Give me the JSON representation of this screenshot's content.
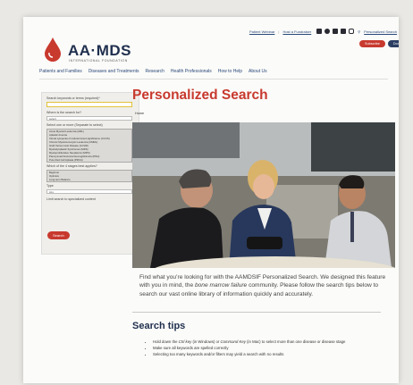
{
  "brand": {
    "logo_text": "AA·MDS",
    "logo_subtitle": "INTERNATIONAL FOUNDATION",
    "accent_red": "#c8392e",
    "navy": "#1f2f4e"
  },
  "top_links": [
    "Patient Webinar",
    "Host a Fundraiser",
    "Personalized Search"
  ],
  "social_icons": [
    "x-icon",
    "facebook-icon",
    "youtube-icon",
    "linkedin-icon",
    "instagram-icon"
  ],
  "top_buttons": {
    "subscribe": "Subscribe",
    "donate": "Donate"
  },
  "nav": {
    "items": [
      "Patients and Families",
      "Diseases and Treatments",
      "Research",
      "Health Professionals",
      "How to Help",
      "About Us"
    ]
  },
  "sidebar": {
    "q1": "Search keywords or terms (required)*",
    "q2": "Where is the search for?",
    "q2_value": "select",
    "q3": "Select one or more (Separate to select)",
    "conditions": [
      "Acute Myeloid Leukemia (AML)",
      "Aplastic Anemia",
      "Clonal cytopenia of undetermined significance (CCUS)",
      "Chronic Myelomonocytic Leukemia (CMML)",
      "Graft Versus Host Disease (GVHD)",
      "Myelodysplastic Syndromes (MDS)",
      "Myeloproliferative Neoplasms (MPN)",
      "Paroxysmal Nocturnal Hemoglobinuria (PNH)",
      "Pure Red Cell Aplasia (PRCA)"
    ],
    "q4": "Which of the 4 stages best applies?",
    "stages": [
      "Beginner",
      "Optimize",
      "Long-term Balance"
    ],
    "q5": "Type",
    "q5_value": "ALL",
    "q6": "Limit search to specialized content",
    "search_button": "Search"
  },
  "main": {
    "title": "Personalized Search",
    "breadcrumb": "Home",
    "intro_1": "Find what you’re looking for with the AAMDSIF Personalized Search.  We designed this feature with you in mind, the ",
    "intro_em": "bone marrow failure",
    "intro_2": " community. Please follow the search tips below to search our vast online library of information quickly and accurately.",
    "tips_title": "Search tips",
    "tip1_a": "Hold down the ",
    "tip1_em1": "Ctrl key",
    "tip1_b": " (in Windows) or ",
    "tip1_em2": "Command Key",
    "tip1_c": " (in Mac) to select more than one disease or disease stage",
    "tip2": "Make sure all keywords are spelled correctly",
    "tip3": "Selecting too many keywords and/or filters may yield a search with no results"
  }
}
